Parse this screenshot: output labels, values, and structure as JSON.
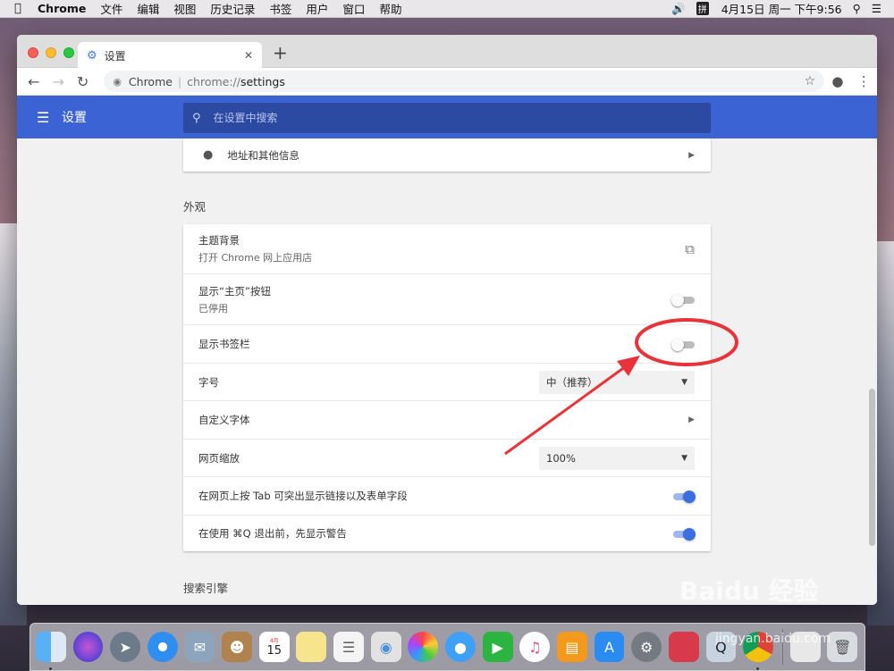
{
  "menubar": {
    "app_name": "Chrome",
    "items": [
      "文件",
      "编辑",
      "视图",
      "历史记录",
      "书签",
      "用户",
      "窗口",
      "帮助"
    ],
    "datetime": "4月15日 周一 下午9:56"
  },
  "tab": {
    "title": "设置",
    "close": "✕",
    "new_tab": "+"
  },
  "omnibox": {
    "site": "Chrome",
    "url_scheme": "chrome://",
    "url_path": "settings"
  },
  "header": {
    "title": "设置",
    "search_placeholder": "在设置中搜索"
  },
  "autofill_row": {
    "label": "地址和其他信息"
  },
  "appearance": {
    "section_title": "外观",
    "theme": {
      "label": "主题背景",
      "sublabel": "打开 Chrome 网上应用店"
    },
    "home_button": {
      "label": "显示“主页”按钮",
      "sublabel": "已停用",
      "enabled": false
    },
    "bookmarks_bar": {
      "label": "显示书签栏",
      "enabled": false
    },
    "font_size": {
      "label": "字号",
      "value": "中（推荐）"
    },
    "custom_fonts": {
      "label": "自定义字体"
    },
    "page_zoom": {
      "label": "网页缩放",
      "value": "100%"
    },
    "tab_highlight": {
      "label": "在网页上按 Tab 可突出显示链接以及表单字段",
      "enabled": true
    },
    "quit_warning": {
      "label": "在使用 ⌘Q 退出前，先显示警告",
      "enabled": true
    }
  },
  "search_engine": {
    "section_title": "搜索引擎"
  },
  "dock": {
    "calendar_day": "15",
    "calendar_month": "4月"
  },
  "watermark": {
    "brand": "Baidu 经验",
    "site": "jingyan.baidu.com"
  },
  "colors": {
    "header_blue": "#3b63d3",
    "toggle_on": "#3b6fe0",
    "annotation_red": "#e8333a"
  }
}
